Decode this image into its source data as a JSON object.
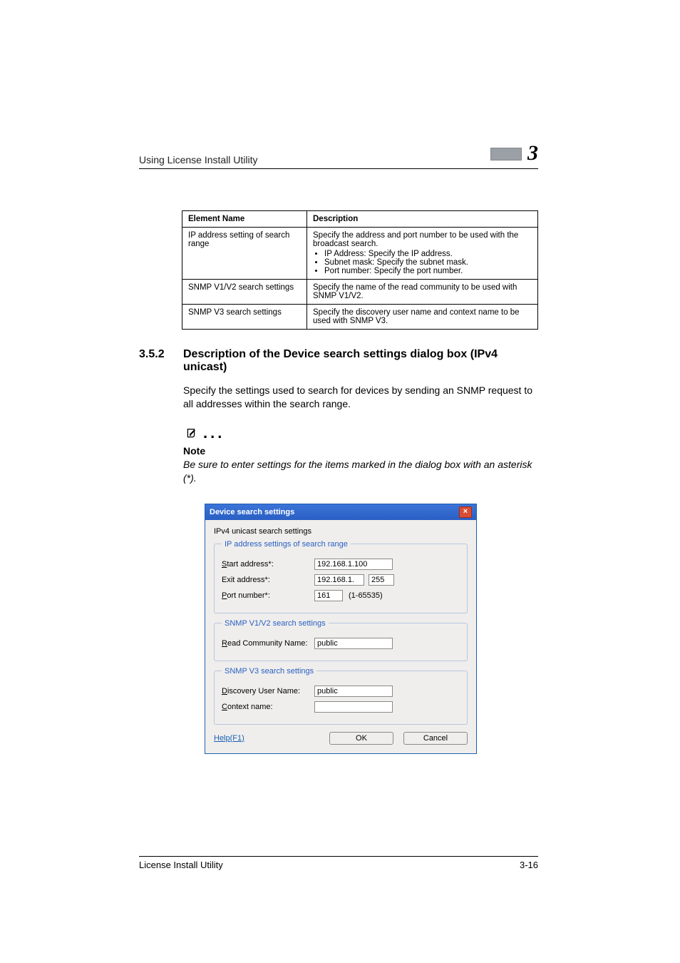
{
  "header": {
    "running_title": "Using License Install Utility",
    "chapter_number": "3"
  },
  "table": {
    "head": {
      "c1": "Element Name",
      "c2": "Description"
    },
    "rows": [
      {
        "name": "IP address setting of search range",
        "desc_intro": "Specify the address and port number to be used with the broadcast search.",
        "bullets": [
          "IP Address: Specify the IP address.",
          "Subnet mask: Specify the subnet mask.",
          "Port number: Specify the port number."
        ]
      },
      {
        "name": "SNMP V1/V2 search settings",
        "desc": "Specify the name of the read community to be used with SNMP V1/V2."
      },
      {
        "name": "SNMP V3 search settings",
        "desc": "Specify the discovery user name and context name to be used with SNMP V3."
      }
    ]
  },
  "section": {
    "number": "3.5.2",
    "title": "Description of the Device search settings dialog box (IPv4 unicast)",
    "paragraph": "Specify the settings used to search for devices by sending an SNMP request to all addresses within the search range."
  },
  "note": {
    "label": "Note",
    "text": "Be sure to enter settings for the items marked in the dialog box with an asterisk (*)."
  },
  "dialog": {
    "title": "Device search settings",
    "caption": "IPv4 unicast search settings",
    "group_ip": {
      "legend": "IP address settings of search range",
      "start_label": "tart address*:",
      "start_value": "192.168.1.100",
      "exit_label": "Exit address*:",
      "exit_prefix": "192.168.1.",
      "exit_last": "255",
      "port_label": "ort number*:",
      "port_value": "161",
      "port_hint": "(1-65535)"
    },
    "group_v12": {
      "legend": "SNMP V1/V2 search settings",
      "read_label": "ead Community Name:",
      "read_value": "public"
    },
    "group_v3": {
      "legend": "SNMP V3 search settings",
      "disc_label": "iscovery User Name:",
      "disc_value": "public",
      "ctx_label": "ontext name:",
      "ctx_value": ""
    },
    "help_label": "Help(F1)",
    "ok_label": "OK",
    "cancel_label": "Cancel"
  },
  "footer": {
    "left": "License Install Utility",
    "right": "3-16"
  }
}
